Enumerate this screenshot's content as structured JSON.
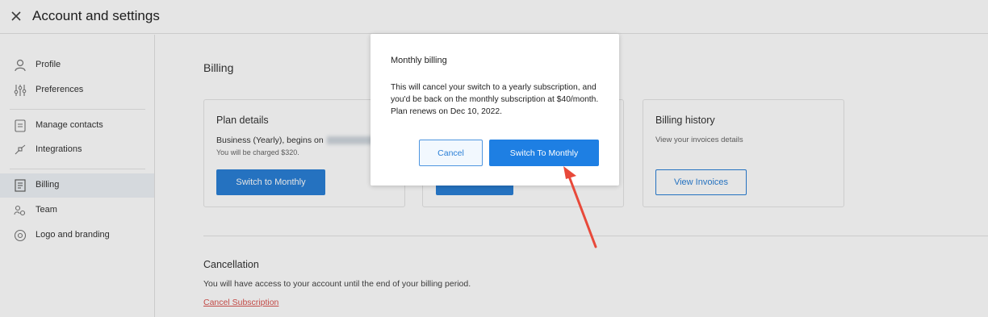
{
  "header": {
    "title": "Account and settings",
    "close_icon": "close-icon"
  },
  "sidebar": {
    "items": [
      {
        "label": "Profile",
        "icon": "user-icon"
      },
      {
        "label": "Preferences",
        "icon": "sliders-icon"
      },
      {
        "label": "Manage contacts",
        "icon": "contacts-icon"
      },
      {
        "label": "Integrations",
        "icon": "integrations-icon"
      },
      {
        "label": "Billing",
        "icon": "billing-icon",
        "active": true
      },
      {
        "label": "Team",
        "icon": "team-icon"
      },
      {
        "label": "Logo and branding",
        "icon": "branding-icon"
      }
    ]
  },
  "main": {
    "title": "Billing",
    "plan_card": {
      "title": "Plan details",
      "plan_text": "Business (Yearly), begins on",
      "charge_text": "You will be charged $320.",
      "button": "Switch to Monthly"
    },
    "history_card": {
      "title": "Billing history",
      "text": "View your invoices details",
      "button": "View Invoices"
    },
    "cancellation": {
      "title": "Cancellation",
      "text": "You will have access to your account until the end of your billing period.",
      "link": "Cancel Subscription"
    }
  },
  "modal": {
    "title": "Monthly billing",
    "body": "This will cancel your switch to a yearly subscription, and you'd be back on the monthly subscription at $40/month. Plan renews on Dec 10, 2022.",
    "cancel_label": "Cancel",
    "confirm_label": "Switch To Monthly"
  },
  "colors": {
    "accent": "#1e7fe3",
    "danger": "#d9534f",
    "annotation": "#e8493a"
  }
}
